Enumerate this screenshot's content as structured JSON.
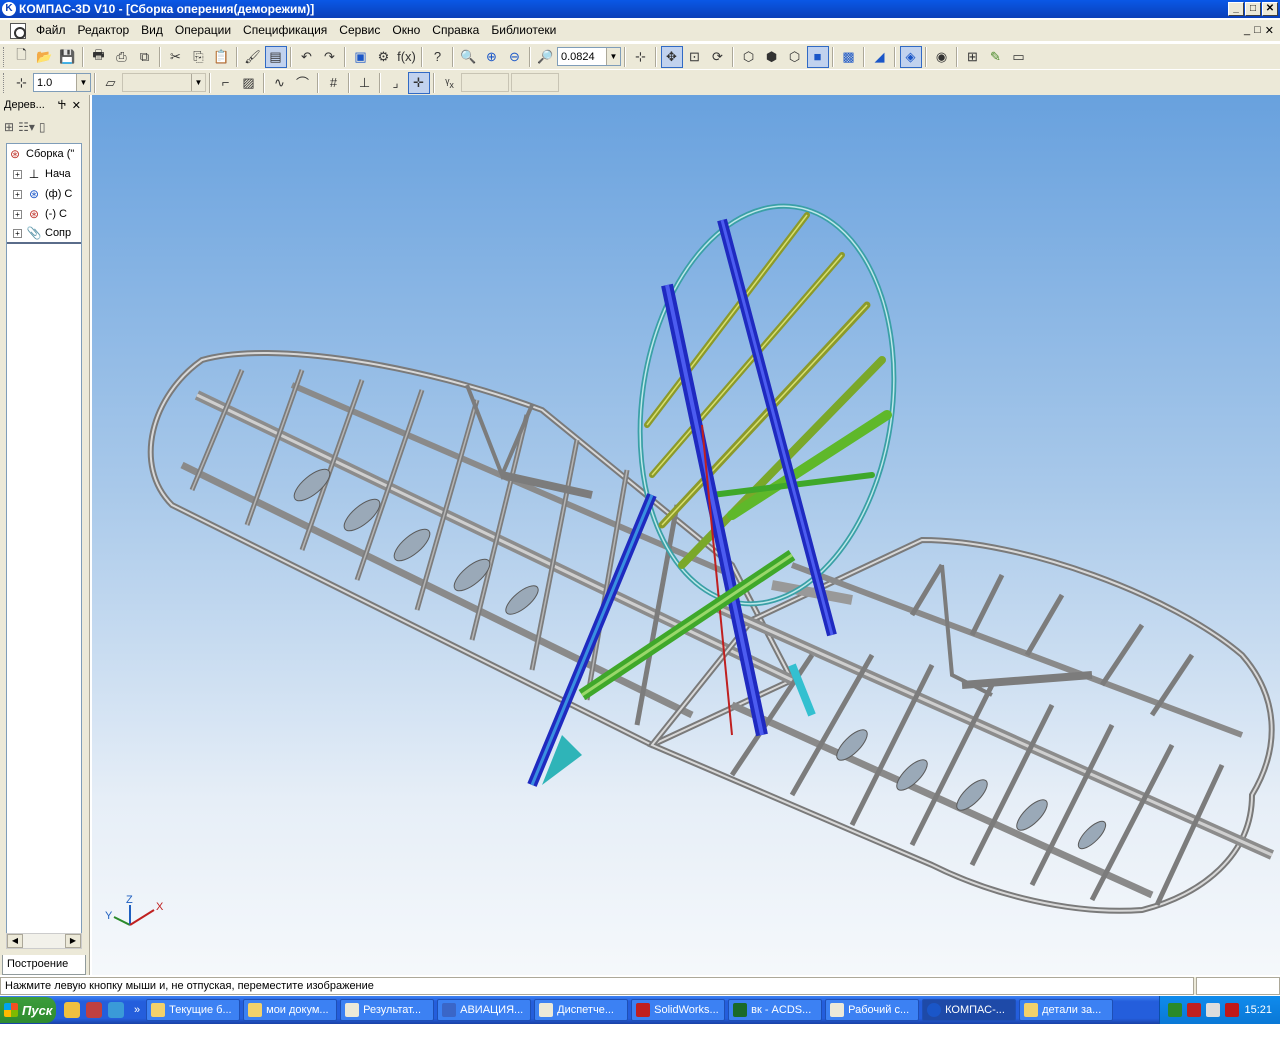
{
  "titlebar": {
    "title": "КОМПАС-3D V10 - [Сборка оперения(деморежим)]",
    "buttons": [
      "_",
      "□",
      "✕"
    ]
  },
  "menubar": {
    "items": [
      "Файл",
      "Редактор",
      "Вид",
      "Операции",
      "Спецификация",
      "Сервис",
      "Окно",
      "Справка",
      "Библиотеки"
    ],
    "doc_controls": [
      "_",
      "□",
      "✕"
    ]
  },
  "toolbar": {
    "zoom_value": "0.0824",
    "step_value": "1.0"
  },
  "tree_panel": {
    "title": "Дерев...",
    "pin": "Ⴕ",
    "close": "✕",
    "items": [
      {
        "label": "Сборка (\"",
        "expander": ""
      },
      {
        "label": "Нача",
        "expander": "+"
      },
      {
        "label": "(ф) С",
        "expander": "+"
      },
      {
        "label": "(-) С",
        "expander": "+"
      },
      {
        "label": "Сопр",
        "expander": "+"
      }
    ],
    "tab_label": "Построение"
  },
  "viewport": {
    "axis_labels": {
      "x": "X",
      "y": "Y",
      "z": "Z"
    }
  },
  "statusbar": {
    "message": "Нажмите левую кнопку мыши и, не отпуская, переместите изображение"
  },
  "taskbar": {
    "start_label": "Пуск",
    "tasks": [
      "Текущие б...",
      "мои докум...",
      "Результат...",
      "АВИАЦИЯ...",
      "Диспетче...",
      "SolidWorks...",
      "вк - ACDS...",
      "Рабочий с...",
      "КОМПАС-...",
      "детали за..."
    ],
    "clock": "15:21",
    "more": "»"
  }
}
